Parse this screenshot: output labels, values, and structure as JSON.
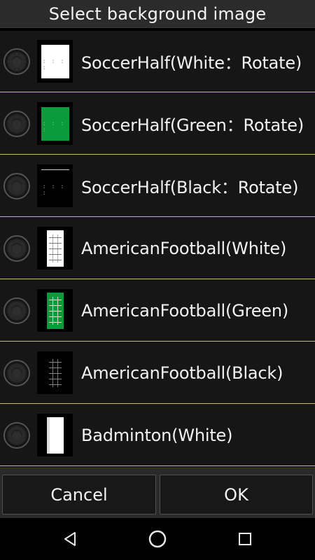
{
  "dialog": {
    "title": "Select background image"
  },
  "items": [
    {
      "label": "SoccerHalf(White：Rotate)",
      "thumb_icon": "soccer-half-white-thumbnail",
      "selected": false
    },
    {
      "label": "SoccerHalf(Green：Rotate)",
      "thumb_icon": "soccer-half-green-thumbnail",
      "selected": false
    },
    {
      "label": "SoccerHalf(Black：Rotate)",
      "thumb_icon": "soccer-half-black-thumbnail",
      "selected": false
    },
    {
      "label": "AmericanFootball(White)",
      "thumb_icon": "american-football-white-thumbnail",
      "selected": false
    },
    {
      "label": "AmericanFootball(Green)",
      "thumb_icon": "american-football-green-thumbnail",
      "selected": false
    },
    {
      "label": "AmericanFootball(Black)",
      "thumb_icon": "american-football-black-thumbnail",
      "selected": false
    },
    {
      "label": "Badminton(White)",
      "thumb_icon": "badminton-white-thumbnail",
      "selected": false
    }
  ],
  "buttons": {
    "cancel": "Cancel",
    "ok": "OK"
  },
  "nav": {
    "back_icon": "back-triangle-icon",
    "home_icon": "home-circle-icon",
    "recents_icon": "recents-square-icon"
  },
  "colors": {
    "divider": "#c8b77a",
    "list_bg": "#161616",
    "title_bg": "#2b2b2b",
    "field_green": "#0a9b3c"
  }
}
